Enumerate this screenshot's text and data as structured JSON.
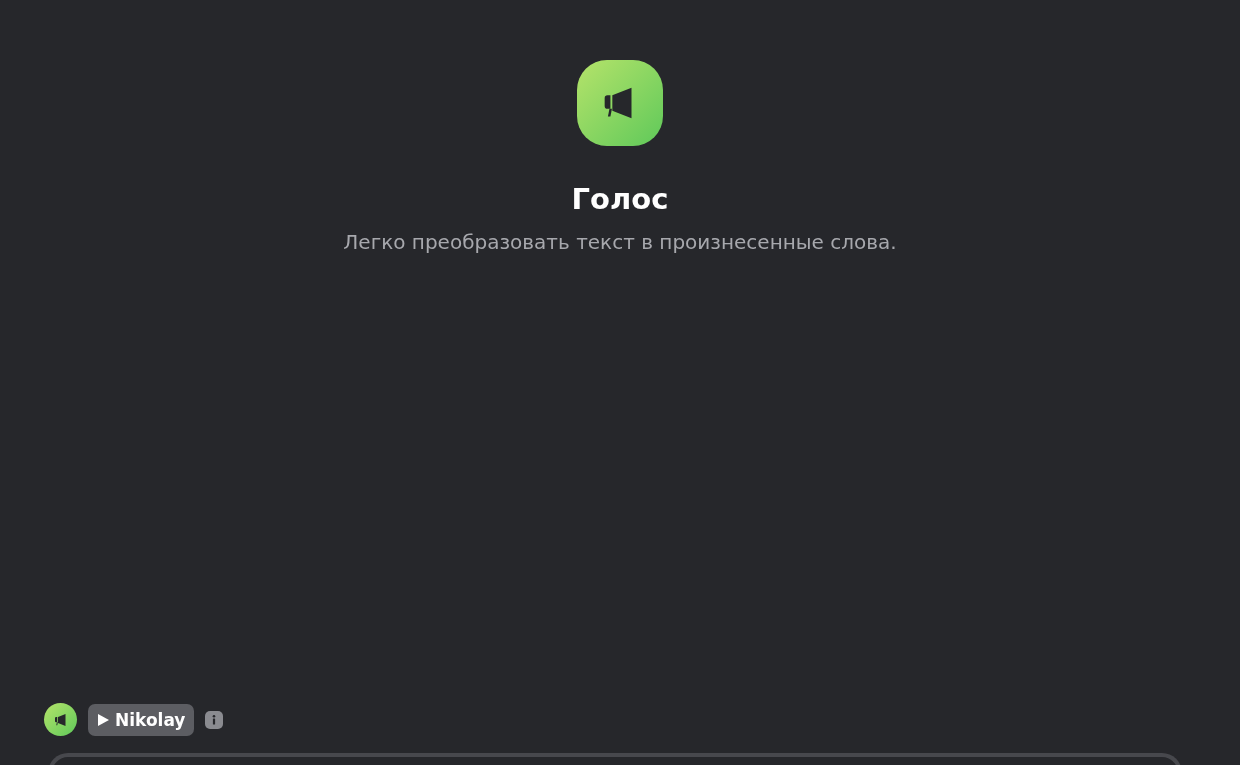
{
  "hero": {
    "title": "Голос",
    "subtitle": "Легко преобразовать текст в произнесенные слова."
  },
  "voice_bar": {
    "voice_name": "Nikolay"
  }
}
